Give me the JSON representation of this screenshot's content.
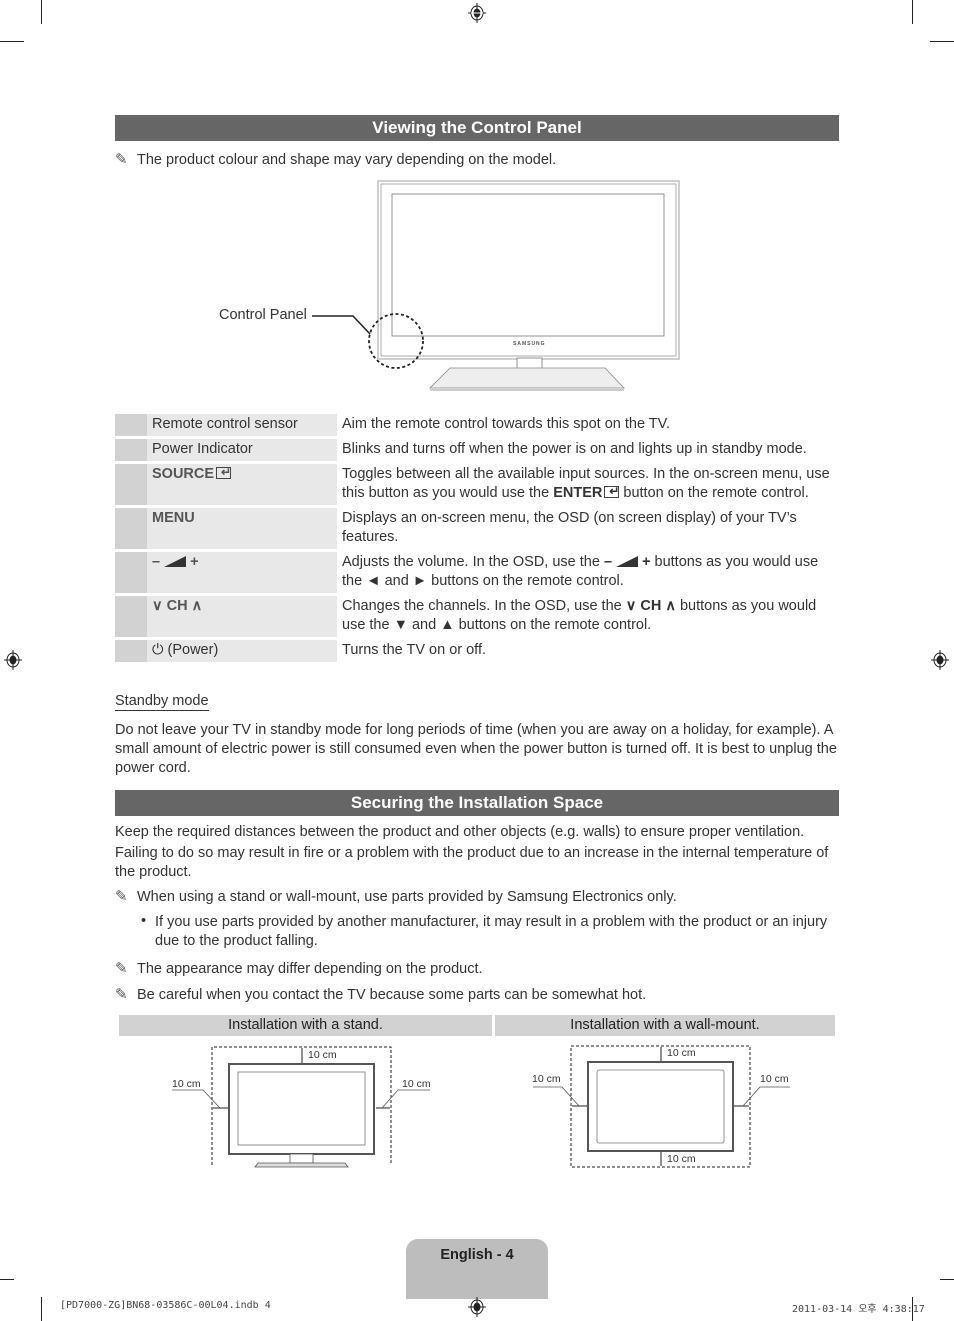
{
  "section1": {
    "title": "Viewing the Control Panel",
    "note": "The product colour and shape may vary depending on the model.",
    "diagram": {
      "callout_label": "Control Panel",
      "brand": "SAMSUNG"
    },
    "controls": [
      {
        "name": "Remote control sensor",
        "description": "Aim the remote control towards this spot on the TV."
      },
      {
        "name": "Power Indicator",
        "description": "Blinks and turns off when the power is on and lights up in standby mode."
      },
      {
        "name": "SOURCE",
        "icon": "enter-icon",
        "description_a": "Toggles between all the available input sources. In the on-screen menu, use this button as you would use the ",
        "description_bold": "ENTER",
        "description_b": " button on the remote control."
      },
      {
        "name": "MENU",
        "description": "Displays an on-screen menu, the OSD (on screen display) of your TV’s features."
      },
      {
        "name_minus": "–",
        "name_plus": "+",
        "icon": "volume-icon",
        "description_a": "Adjusts the volume. In the OSD, use the ",
        "description_minus": "–",
        "description_plus": "+",
        "description_b": " buttons as you would use the ◄ and ► buttons on the remote control."
      },
      {
        "name_down": "∨",
        "name_ch": "CH",
        "name_up": "∧",
        "description_a": "Changes the channels. In the OSD, use the ",
        "description_ch": "∨ CH ∧",
        "description_b": " buttons as you would use the ▼ and ▲ buttons on the remote control."
      },
      {
        "icon": "power-icon",
        "name": "(Power)",
        "description": "Turns the TV on or off."
      }
    ],
    "standby": {
      "heading": "Standby mode",
      "text": "Do not leave your TV in standby mode for long periods of time (when you are away on a holiday, for example). A small amount of electric power is still consumed even when the power button is turned off. It is best to unplug the power cord."
    }
  },
  "section2": {
    "title": "Securing the Installation Space",
    "para1": "Keep the required distances between the product and other objects (e.g. walls) to ensure proper ventilation.",
    "para2": "Failing to do so may result in fire or a problem with the product due to an increase in the internal temperature of the product.",
    "note1": "When using a stand or wall-mount, use parts provided by Samsung Electronics only.",
    "bullet1": "If you use parts provided by another manufacturer, it may result in a problem with the product or an injury due to the product falling.",
    "note2": "The appearance may differ depending on the product.",
    "note3": "Be careful when you contact the TV because some parts can be somewhat hot.",
    "stand": {
      "heading": "Installation with a stand.",
      "top": "10 cm",
      "left": "10 cm",
      "right": "10 cm"
    },
    "wall": {
      "heading": "Installation with a wall-mount.",
      "top": "10 cm",
      "left": "10 cm",
      "right": "10 cm",
      "bottom": "10 cm"
    }
  },
  "footer": {
    "page_label": "English - 4",
    "file_info": "[PD7000-ZG]BN68-03586C-00L04.indb   4",
    "timestamp": "2011-03-14   오후 4:38:17"
  }
}
